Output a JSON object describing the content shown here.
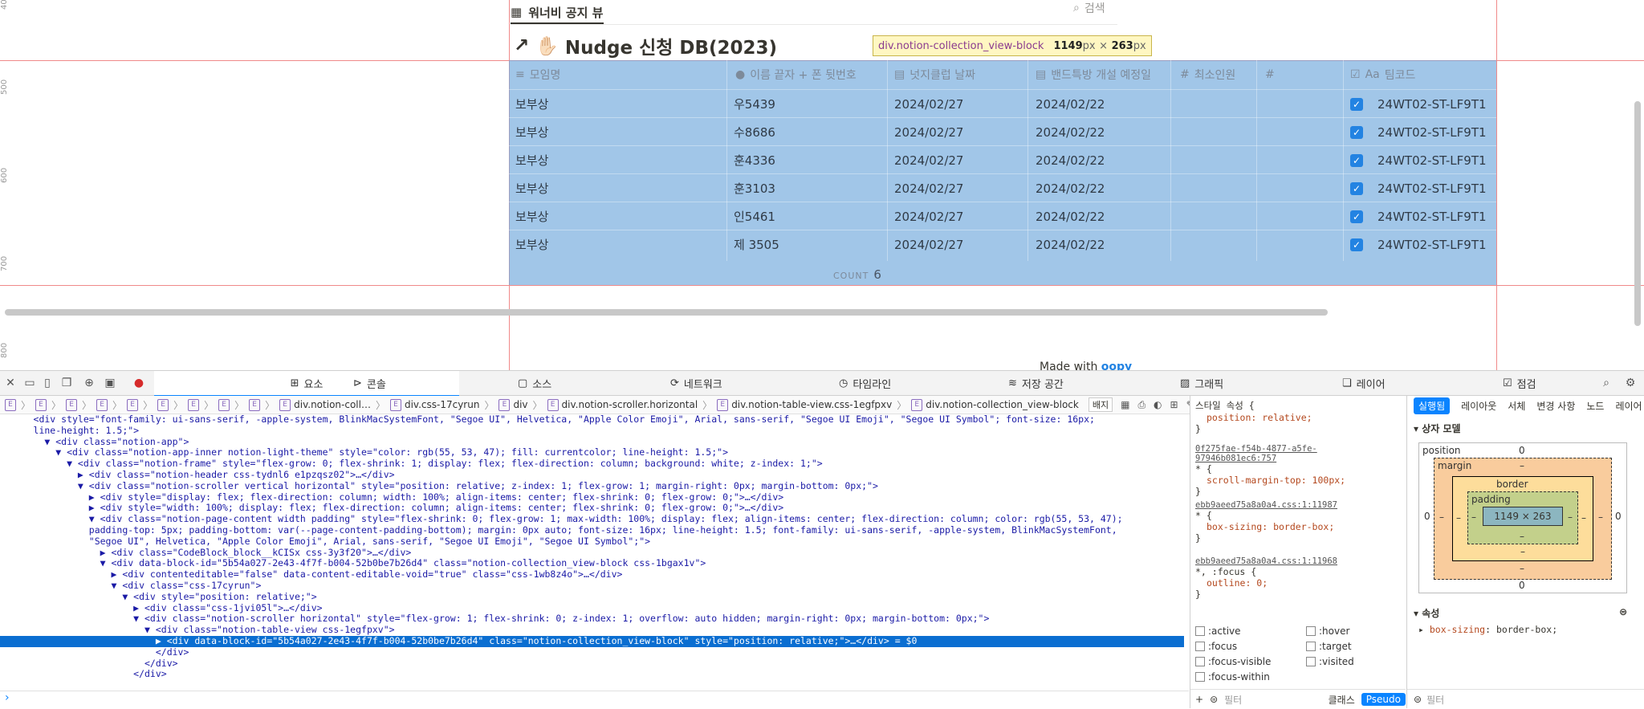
{
  "page": {
    "view_tab_label": "워너비 공지 뷰",
    "search_label": "검색",
    "db_title": "Nudge 신청 DB(2023)",
    "db_emoji": "✋🏻",
    "ruler_labels": [
      "400",
      "500",
      "600",
      "700",
      "800"
    ],
    "tooltip": {
      "selector": "div.notion-collection_view-block",
      "width": "1149",
      "height": "263",
      "unit": "px",
      "times": "×"
    },
    "columns": [
      "모임명",
      "이름 끝자 + 폰 뒷번호",
      "넛지클럽 날짜",
      "밴드특방 개설 예정일",
      "최소인원",
      "",
      "팀코드"
    ],
    "rows": [
      {
        "group": "보부상",
        "name": "우5439",
        "date": "2024/02/27",
        "open": "2024/02/22",
        "code": "24WT02-ST-LF9T1"
      },
      {
        "group": "보부상",
        "name": "수8686",
        "date": "2024/02/27",
        "open": "2024/02/22",
        "code": "24WT02-ST-LF9T1"
      },
      {
        "group": "보부상",
        "name": "훈4336",
        "date": "2024/02/27",
        "open": "2024/02/22",
        "code": "24WT02-ST-LF9T1"
      },
      {
        "group": "보부상",
        "name": "훈3103",
        "date": "2024/02/27",
        "open": "2024/02/22",
        "code": "24WT02-ST-LF9T1"
      },
      {
        "group": "보부상",
        "name": "인5461",
        "date": "2024/02/27",
        "open": "2024/02/22",
        "code": "24WT02-ST-LF9T1"
      },
      {
        "group": "보부상",
        "name": "제 3505",
        "date": "2024/02/27",
        "open": "2024/02/22",
        "code": "24WT02-ST-LF9T1"
      }
    ],
    "count_label": "COUNT",
    "count_value": "6",
    "made_with": "Made with",
    "made_with_brand": "oopy"
  },
  "devtools": {
    "tabs": [
      "요소",
      "콘솔",
      "소스",
      "네트워크",
      "타임라인",
      "저장 공간",
      "그래픽",
      "레이어",
      "점검"
    ],
    "breadcrumbs": [
      "div.notion-coll…",
      "div.css-17cyrun",
      "div",
      "div.notion-scroller.horizontal",
      "div.notion-table-view.css-1egfpxv",
      "div.notion-collection_view-block"
    ],
    "badge_label": "배지",
    "dom_lines": [
      "      <div style=\"font-family: ui-sans-serif, -apple-system, BlinkMacSystemFont, \"Segoe UI\", Helvetica, \"Apple Color Emoji\", Arial, sans-serif, \"Segoe UI Emoji\", \"Segoe UI Symbol\"; font-size: 16px;",
      "      line-height: 1.5;\">",
      "        ▼ <div class=\"notion-app\">",
      "          ▼ <div class=\"notion-app-inner notion-light-theme\" style=\"color: rgb(55, 53, 47); fill: currentcolor; line-height: 1.5;\">",
      "            ▼ <div class=\"notion-frame\" style=\"flex-grow: 0; flex-shrink: 1; display: flex; flex-direction: column; background: white; z-index: 1;\">",
      "              ▶ <div class=\"notion-header css-tydnl6 e1pzqsz02\">…</div>",
      "              ▼ <div class=\"notion-scroller vertical horizontal\" style=\"position: relative; z-index: 1; flex-grow: 1; margin-right: 0px; margin-bottom: 0px;\">",
      "                ▶ <div style=\"display: flex; flex-direction: column; width: 100%; align-items: center; flex-shrink: 0; flex-grow: 0;\">…</div>",
      "                ▶ <div style=\"width: 100%; display: flex; flex-direction: column; align-items: center; flex-shrink: 0; flex-grow: 0;\">…</div>",
      "                ▼ <div class=\"notion-page-content width padding\" style=\"flex-shrink: 0; flex-grow: 1; max-width: 100%; display: flex; align-items: center; flex-direction: column; color: rgb(55, 53, 47);",
      "                padding-top: 5px; padding-bottom: var(--page-content-padding-bottom); margin: 0px auto; font-size: 16px; line-height: 1.5; font-family: ui-sans-serif, -apple-system, BlinkMacSystemFont,",
      "                \"Segoe UI\", Helvetica, \"Apple Color Emoji\", Arial, sans-serif, \"Segoe UI Emoji\", \"Segoe UI Symbol\";\">",
      "                  ▶ <div class=\"CodeBlock_block__kCISx css-3y3f20\">…</div>",
      "                  ▼ <div data-block-id=\"5b54a027-2e43-4f7f-b004-52b0be7b26d4\" class=\"notion-collection_view-block css-1bgax1v\">",
      "                    ▶ <div contenteditable=\"false\" data-content-editable-void=\"true\" class=\"css-1wb8z4o\">…</div>",
      "                    ▼ <div class=\"css-17cyrun\">",
      "                      ▼ <div style=\"position: relative;\">",
      "                        ▶ <div class=\"css-1jvi05l\">…</div>",
      "                        ▼ <div class=\"notion-scroller horizontal\" style=\"flex-grow: 1; flex-shrink: 0; z-index: 1; overflow: auto hidden; margin-right: 0px; margin-bottom: 0px;\">",
      "                          ▼ <div class=\"notion-table-view css-1egfpxv\">",
      "                            ▶ <div data-block-id=\"5b54a027-2e43-4f7f-b004-52b0be7b26d4\" class=\"notion-collection_view-block\" style=\"position: relative;\">…</div> = $0",
      "                            </div>",
      "                          </div>",
      "                        </div>"
    ],
    "styles": {
      "rule1_title": "스타일 속성 {",
      "rule1_body": "position: relative;",
      "rule2_src": "0f275fae-f54b-4877-a5fe-97946b081ec6:757",
      "rule2_body": "scroll-margin-top: 100px;",
      "rule3_src": "ebb9aeed75a8a0a4.css:1:11987",
      "rule3_body": "box-sizing: border-box;",
      "rule4_src": "ebb9aeed75a8a0a4.css:1:11968",
      "rule4_sel": "*, :focus {",
      "rule4_body": "outline: 0;",
      "pseudos": [
        ":active",
        ":hover",
        ":focus",
        ":target",
        ":focus-visible",
        ":visited",
        ":focus-within"
      ],
      "filter_placeholder": "필터",
      "class_label": "클래스",
      "pseudo_label": "Pseudo"
    },
    "layout_pane": {
      "tabs": [
        "실행됨",
        "레이아웃",
        "서체",
        "변경 사항",
        "노드",
        "레이어"
      ],
      "section_box": "상자 모델",
      "position_label": "position",
      "position_value": "0",
      "margin_label": "margin",
      "border_label": "border",
      "padding_label": "padding",
      "content_size": "1149 × 263",
      "dash": "–",
      "zero": "0",
      "section_props": "속성",
      "prop_name": "box-sizing",
      "prop_value": "border-box;",
      "filter_placeholder": "필터"
    }
  }
}
